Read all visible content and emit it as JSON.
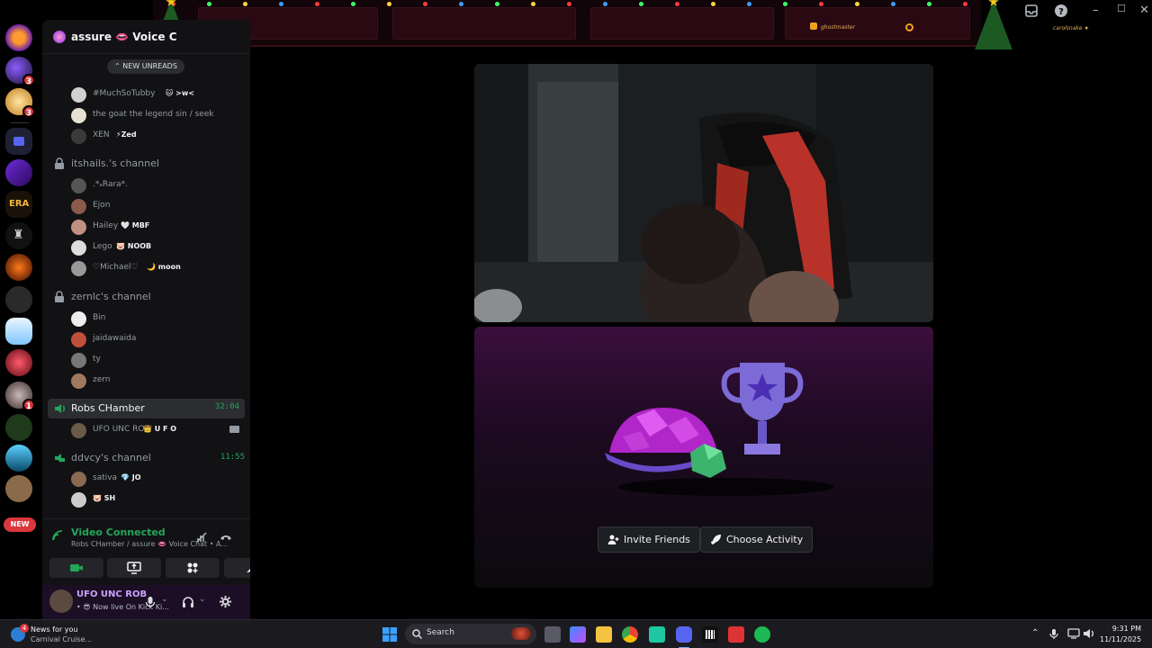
{
  "server": {
    "name": "assure 👄 Voice C"
  },
  "new_unreads_label": "NEW UNREADS",
  "new_pill_label": "NEW",
  "rail_badges": [
    "3",
    "3",
    "1"
  ],
  "top_members": [
    {
      "name": "#MuchSoTubby",
      "tag": "🐱 >w<"
    },
    {
      "name": "the goat the legend sin / seek",
      "tag": ""
    },
    {
      "name": "XEN",
      "tag": "⚡Zed"
    }
  ],
  "channels": [
    {
      "name": "itshails.'s channel",
      "locked": true,
      "time": "",
      "members": [
        {
          "name": ".*ₐRara*.",
          "tag": ""
        },
        {
          "name": "Ejon",
          "tag": ""
        },
        {
          "name": "Hailey",
          "tag": "🤍 MBF"
        },
        {
          "name": "Lego",
          "tag": "🐷 NOOB"
        },
        {
          "name": "♡Michael♡",
          "tag": "🌙 moon"
        }
      ]
    },
    {
      "name": "zernlc's channel",
      "locked": true,
      "time": "",
      "members": [
        {
          "name": "Bin",
          "tag": ""
        },
        {
          "name": "jaidawaida",
          "tag": ""
        },
        {
          "name": "ty",
          "tag": ""
        },
        {
          "name": "zern",
          "tag": ""
        }
      ]
    },
    {
      "name": "Robs CHamber",
      "locked": false,
      "time": "32:04",
      "active": true,
      "members": [
        {
          "name": "UFO UNC ROB",
          "tag": "👑 U F O",
          "camera": true
        }
      ]
    },
    {
      "name": "ddvcy's channel",
      "locked": false,
      "time": "11:55",
      "members": [
        {
          "name": "sativa",
          "tag": "💎 JO"
        },
        {
          "name": "",
          "tag": "🐷 SH"
        }
      ]
    }
  ],
  "voice_panel": {
    "status": "Video Connected",
    "subtitle": "Robs CHamber / assure 👄 Voice Chat • A..."
  },
  "user_panel": {
    "username": "UFO UNC ROB",
    "status": "• 😎 Now live On Kick Ki..."
  },
  "activity": {
    "invite_label": "Invite Friends",
    "choose_label": "Choose Activity"
  },
  "banner": {
    "left_name": "ghostmaster",
    "right_name": "carolsnake ★"
  },
  "taskbar": {
    "news_title": "News for you",
    "news_sub": "Carnival Cruise...",
    "news_count": "4",
    "search_label": "Search",
    "time": "9:31 PM",
    "date": "11/11/2025"
  },
  "colors": {
    "accent_green": "#23a55a",
    "danger_red": "#da373c",
    "activity_purple": "#3a0f3d"
  }
}
